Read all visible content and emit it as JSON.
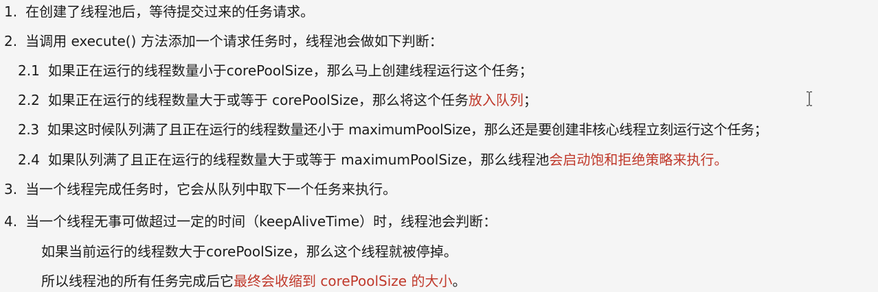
{
  "lines": [
    {
      "num": "1.",
      "segments": [
        "在创建了线程池后，等待提交过来的任务请求。"
      ]
    },
    {
      "num": "2.",
      "segments": [
        "当调用 execute() 方法添加一个请求任务时，线程池会做如下判断："
      ]
    },
    {
      "num": "2.1",
      "segments": [
        "如果正在运行的线程数量小于corePoolSize，那么马上创建线程运行这个任务；"
      ]
    },
    {
      "num": "2.2",
      "segments": [
        "如果正在运行的线程数量大于或等于 corePoolSize，那么将这个任务",
        "放入队列",
        "；"
      ]
    },
    {
      "num": "2.3",
      "segments": [
        "如果这时候队列满了且正在运行的线程数量还小于 maximumPoolSize，那么还是要创建非核心线程立刻运行这个任务；"
      ]
    },
    {
      "num": "2.4",
      "segments": [
        "如果队列满了且正在运行的线程数量大于或等于 maximumPoolSize，那么线程池",
        "会启动饱和拒绝策略来执行。"
      ]
    },
    {
      "num": "3.",
      "segments": [
        "当一个线程完成任务时，它会从队列中取下一个任务来执行。"
      ]
    },
    {
      "num": "4.",
      "segments": [
        "当一个线程无事可做超过一定的时间（keepAliveTime）时，线程池会判断："
      ]
    },
    {
      "num": "",
      "segments": [
        "如果当前运行的线程数大于corePoolSize，那么这个线程就被停掉。"
      ]
    },
    {
      "num": "",
      "segments": [
        "所以线程池的所有任务完成后它",
        "最终会收缩到 corePoolSize 的大小",
        "。"
      ]
    }
  ],
  "colors": {
    "text": "#1c1c1c",
    "highlight": "#c0392b",
    "background": "#f5f5f5"
  },
  "icons": {
    "cursor": "text-cursor-icon"
  }
}
